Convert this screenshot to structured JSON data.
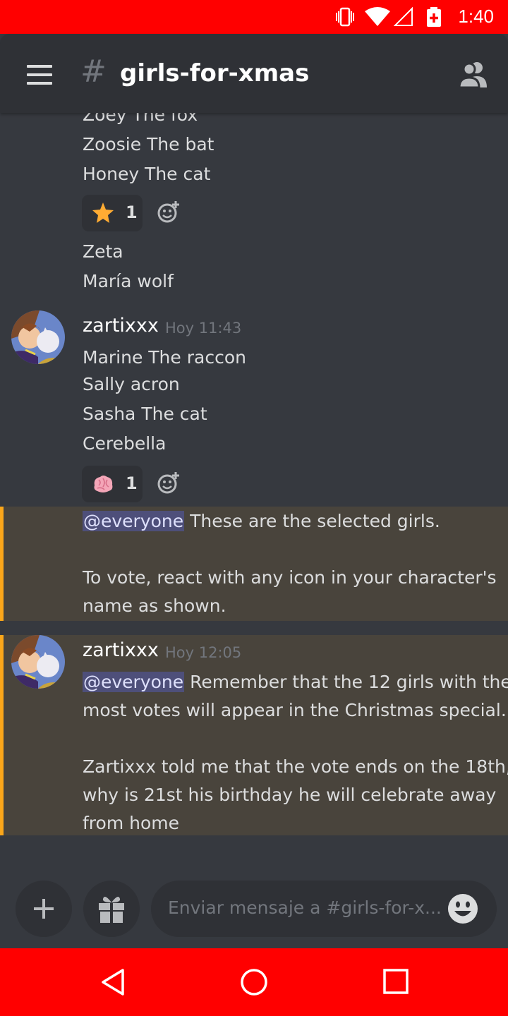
{
  "status_bar": {
    "time": "1:40",
    "icons": [
      "vibrate-icon",
      "wifi-icon",
      "signal-icon",
      "battery-icon"
    ],
    "color": "#ff0000"
  },
  "header": {
    "channel_name": "girls-for-xmas",
    "hash_symbol": "#",
    "icons": [
      "menu-icon",
      "members-icon"
    ]
  },
  "messages": {
    "block1": {
      "lines": [
        "Zoey The fox",
        "Zoosie The bat",
        "Honey The cat"
      ],
      "reaction": {
        "emoji": "star",
        "count": "1"
      },
      "lines_after": [
        "Zeta",
        "María wolf"
      ]
    },
    "msg2": {
      "username": "zartixxx",
      "timestamp": "Hoy 11:43",
      "lines": [
        "Marine The raccon",
        "Sally acron",
        "Sasha The cat",
        "Cerebella"
      ],
      "reaction": {
        "emoji": "brain",
        "count": "1"
      },
      "mention": "@everyone",
      "mention_text": " These are the selected girls.",
      "body_lines": [
        "To vote, react with any icon in your character's",
        "name as shown."
      ]
    },
    "msg3": {
      "username": "zartixxx",
      "timestamp": "Hoy 12:05",
      "mention": "@everyone",
      "mention_text": " Remember that the 12 girls with the",
      "line2": "most votes will appear in the Christmas special.",
      "body_lines": [
        "Zartixxx told me that the vote ends on the 18th,",
        "why is 21st his birthday he will celebrate away",
        "from home"
      ]
    }
  },
  "composer": {
    "placeholder": "Enviar mensaje a #girls-for-x...",
    "icons": [
      "plus-icon",
      "gift-icon",
      "emoji-icon"
    ]
  },
  "nav_bar": {
    "icons": [
      "back-icon",
      "home-icon",
      "recents-icon"
    ]
  },
  "colors": {
    "background": "#36393f",
    "header": "#2f3136",
    "highlight": "#49443c",
    "highlight_border": "#faa61a",
    "mention_bg": "#4e4f7a"
  }
}
